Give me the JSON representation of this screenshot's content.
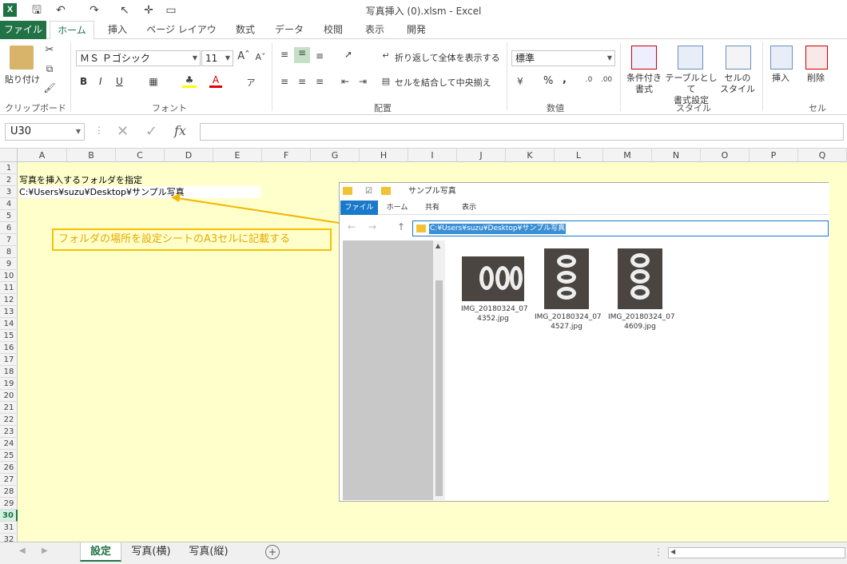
{
  "window": {
    "title": "写真挿入 (0).xlsm - Excel"
  },
  "ribbon_tabs": [
    "ファイル",
    "ホーム",
    "挿入",
    "ページ レイアウト",
    "数式",
    "データ",
    "校閲",
    "表示",
    "開発"
  ],
  "ribbon": {
    "clipboard": {
      "paste": "貼り付け",
      "group": "クリップボード"
    },
    "font": {
      "name": "ＭＳ Ｐゴシック",
      "size": "11",
      "bold": "B",
      "italic": "I",
      "underline": "U",
      "group": "フォント"
    },
    "alignment": {
      "wrap": "折り返して全体を表示する",
      "merge": "セルを結合して中央揃え",
      "group": "配置"
    },
    "number": {
      "format": "標準",
      "percent": "%",
      "comma": ",",
      "group": "数値"
    },
    "styles": {
      "conditional": "条件付き\n書式",
      "table": "テーブルとして\n書式設定",
      "cell": "セルの\nスタイル",
      "group": "スタイル"
    },
    "cells": {
      "insert": "挿入",
      "delete": "削除",
      "group": "セル"
    }
  },
  "formula_bar": {
    "name_box": "U30",
    "fx": "fx",
    "value": ""
  },
  "columns": [
    "A",
    "B",
    "C",
    "D",
    "E",
    "F",
    "G",
    "H",
    "I",
    "J",
    "K",
    "L",
    "M",
    "N",
    "O",
    "P",
    "Q"
  ],
  "rows": [
    "1",
    "2",
    "3",
    "4",
    "5",
    "6",
    "7",
    "8",
    "9",
    "10",
    "11",
    "12",
    "13",
    "14",
    "15",
    "16",
    "17",
    "18",
    "19",
    "20",
    "21",
    "22",
    "23",
    "24",
    "25",
    "26",
    "27",
    "28",
    "29",
    "30",
    "31",
    "32"
  ],
  "selected_row": "30",
  "cells": {
    "A2": "写真を挿入するフォルダを指定",
    "A3": "C:¥Users¥suzu¥Desktop¥サンプル写真"
  },
  "callout": "フォルダの場所を設定シートのA3セルに記載する",
  "explorer": {
    "title": "サンプル写真",
    "tabs": [
      "ファイル",
      "ホーム",
      "共有",
      "表示"
    ],
    "address": "C:¥Users¥suzu¥Desktop¥サンプル写真",
    "files": [
      {
        "name": "IMG_20180324_07\n4352.jpg"
      },
      {
        "name": "IMG_20180324_07\n4527.jpg"
      },
      {
        "name": "IMG_20180324_07\n4609.jpg"
      }
    ]
  },
  "sheet_tabs": [
    "設定",
    "写真(横)",
    "写真(縦)"
  ],
  "active_sheet": "設定"
}
